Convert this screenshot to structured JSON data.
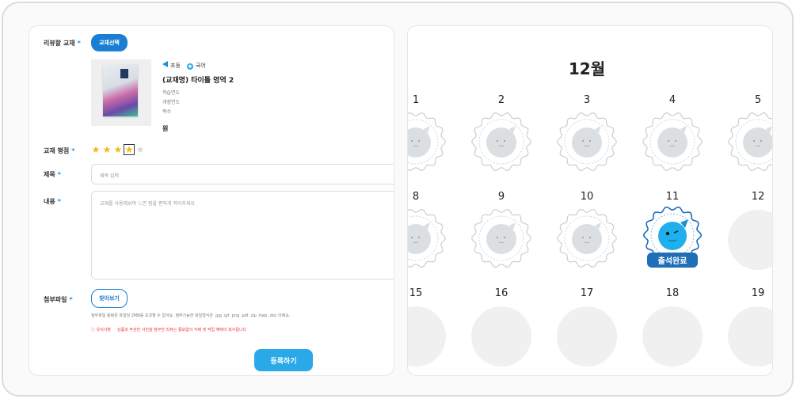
{
  "form": {
    "book_label": "리뷰할 교재",
    "req_mark": "*",
    "pick_button": "교재선택",
    "book": {
      "level": "초등",
      "subject": "국어",
      "title": "(교재명) 타이틀 영역 2",
      "line1": "학습연도",
      "line2": "개정연도",
      "line3": "쪽수",
      "price": "원"
    },
    "rating_label": "교재 평점",
    "rating": 4,
    "rating_max": 5,
    "title_label": "제목",
    "title_placeholder": "제목 입력",
    "content_label": "내용",
    "content_placeholder": "교재를 사용해보며 느낀 점을 편하게 적어주세요",
    "attach_label": "첨부파일",
    "browse_button": "찾아보기",
    "attach_note": "첨부파일 용량은 파일당 2MB를 초과할 수 없어요. 첨부가능한 파일형식은 .jpg .gif .png .pdf .zip .hwp .doc 이에요.",
    "warn_title": "ⓘ 유의사항",
    "warn_text": "상품과 무관한 사진을 첨부한 리뷰는 통보없이 삭제 및 적립 혜택이 회수됩니다",
    "submit_button": "등록하기"
  },
  "calendar": {
    "month": "12월",
    "done_label": "출석완료",
    "rows": [
      [
        {
          "day": "1",
          "state": "stamp"
        },
        {
          "day": "2",
          "state": "stamp"
        },
        {
          "day": "3",
          "state": "stamp"
        },
        {
          "day": "4",
          "state": "stamp"
        },
        {
          "day": "5",
          "state": "stamp"
        }
      ],
      [
        {
          "day": "8",
          "state": "stamp"
        },
        {
          "day": "9",
          "state": "stamp"
        },
        {
          "day": "10",
          "state": "stamp"
        },
        {
          "day": "11",
          "state": "done"
        },
        {
          "day": "12",
          "state": "empty"
        }
      ],
      [
        {
          "day": "15",
          "state": "empty"
        },
        {
          "day": "16",
          "state": "empty"
        },
        {
          "day": "17",
          "state": "empty"
        },
        {
          "day": "18",
          "state": "empty"
        },
        {
          "day": "19",
          "state": "empty"
        }
      ]
    ]
  },
  "colors": {
    "primary": "#1a7fd4",
    "accent": "#29a9e8",
    "star": "#f3b816",
    "warning": "#e33333",
    "stamp_gray": "#dcdfe2"
  }
}
